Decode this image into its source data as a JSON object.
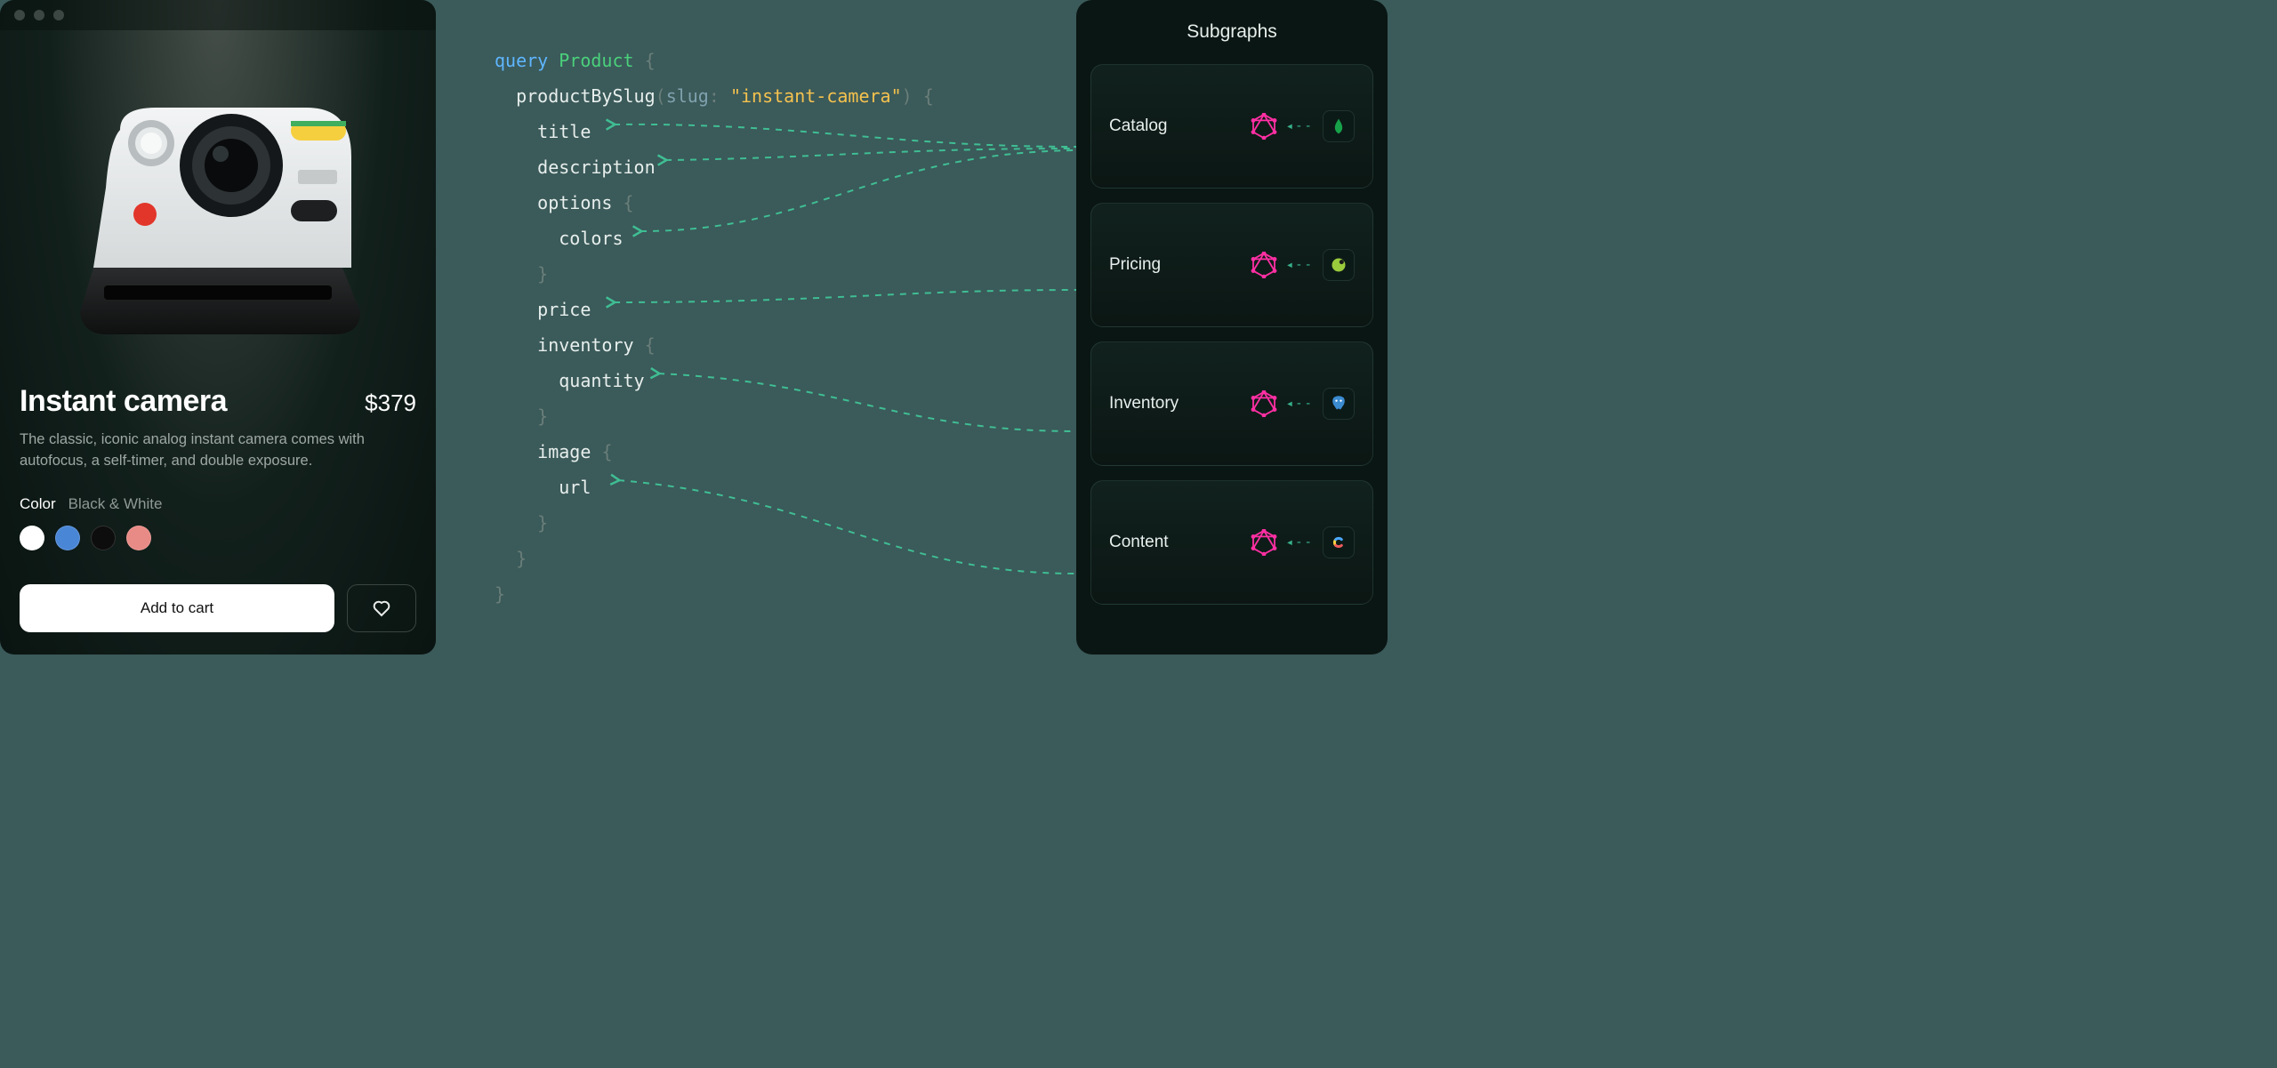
{
  "product": {
    "title": "Instant camera",
    "price": "$379",
    "description": "The classic, iconic analog instant camera comes with autofocus, a self-timer, and double exposure.",
    "color_label": "Color",
    "color_value": "Black & White",
    "swatches": [
      "#ffffff",
      "#4a86d6",
      "#0d0d0d",
      "#e88a85"
    ],
    "add_to_cart_label": "Add to cart"
  },
  "code": {
    "keyword": "query",
    "operation_name": "Product",
    "resolver": "productBySlug",
    "arg_name": "slug",
    "arg_value": "\"instant-camera\"",
    "fields": {
      "title": "title",
      "description": "description",
      "options": "options",
      "colors": "colors",
      "price": "price",
      "inventory": "inventory",
      "quantity": "quantity",
      "image": "image",
      "url": "url"
    }
  },
  "subgraphs": {
    "title": "Subgraphs",
    "items": [
      {
        "name": "Catalog",
        "source_icon": "mongodb"
      },
      {
        "name": "Pricing",
        "source_icon": "database"
      },
      {
        "name": "Inventory",
        "source_icon": "postgres"
      },
      {
        "name": "Content",
        "source_icon": "contentful"
      }
    ]
  }
}
